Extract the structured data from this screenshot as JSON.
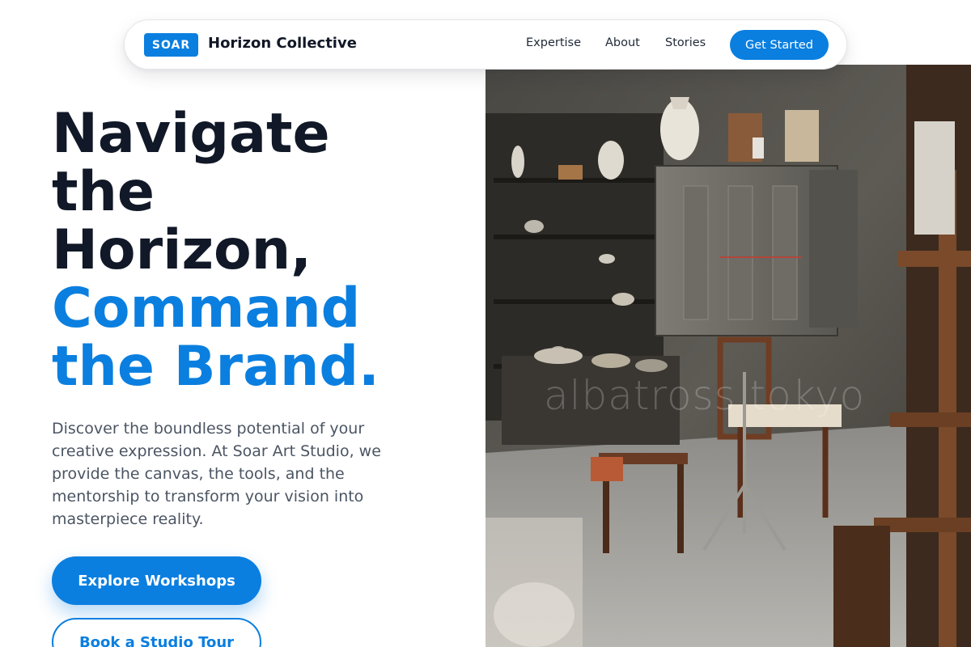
{
  "nav": {
    "badge": "SOAR",
    "brand_name": "Horizon Collective",
    "links": [
      "Expertise",
      "About",
      "Stories"
    ],
    "cta": "Get Started"
  },
  "hero": {
    "headline_lines": [
      "Navigate",
      "the",
      "Horizon,"
    ],
    "accent_lines": [
      "Command",
      "the Brand."
    ],
    "description": "Discover the boundless potential of your creative expression. At Soar Art Studio, we provide the canvas, the tools, and the mentorship to transform your vision into masterpiece reality.",
    "primary_button": "Explore Workshops",
    "secondary_button": "Book a Studio Tour"
  },
  "image": {
    "subject": "cluttered art studio interior with pottery, shelves, kiln and wooden chairs",
    "watermark": "albatross tokyo"
  },
  "colors": {
    "accent": "#0a7fe0",
    "heading": "#111827",
    "body_text": "#4b5563",
    "background": "#ffffff"
  }
}
